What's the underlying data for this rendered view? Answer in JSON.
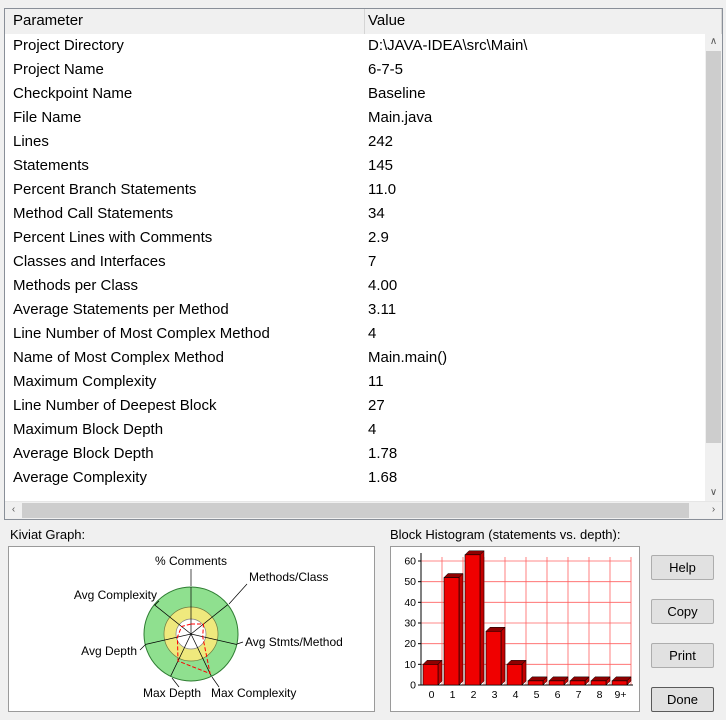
{
  "table": {
    "columns": [
      "Parameter",
      "Value"
    ],
    "rows": [
      [
        "Project Directory",
        "D:\\JAVA-IDEA\\src\\Main\\"
      ],
      [
        "Project Name",
        "6-7-5"
      ],
      [
        "Checkpoint Name",
        "Baseline"
      ],
      [
        "File Name",
        "Main.java"
      ],
      [
        "Lines",
        "242"
      ],
      [
        "Statements",
        "145"
      ],
      [
        "Percent Branch Statements",
        "11.0"
      ],
      [
        "Method Call Statements",
        "34"
      ],
      [
        "Percent Lines with Comments",
        "2.9"
      ],
      [
        "Classes and Interfaces",
        "7"
      ],
      [
        "Methods per Class",
        "4.00"
      ],
      [
        "Average Statements per Method",
        "3.11"
      ],
      [
        "Line Number of Most Complex Method",
        "4"
      ],
      [
        "Name of Most Complex Method",
        "Main.main()"
      ],
      [
        "Maximum Complexity",
        "11"
      ],
      [
        "Line Number of Deepest Block",
        "27"
      ],
      [
        "Maximum Block Depth",
        "4"
      ],
      [
        "Average Block Depth",
        "1.78"
      ],
      [
        "Average Complexity",
        "1.68"
      ]
    ]
  },
  "sections": {
    "kiviat_label": "Kiviat Graph:",
    "histogram_label": "Block Histogram (statements vs. depth):"
  },
  "buttons": {
    "help": "Help",
    "copy": "Copy",
    "print": "Print",
    "done": "Done"
  },
  "icons": {
    "scroll_up": "∧",
    "scroll_down": "∨",
    "scroll_left": "‹",
    "scroll_right": "›"
  },
  "colors": {
    "bar_red": "#f00000",
    "bar_top_red": "#8f0000",
    "bar_side_red": "#c40000",
    "grid_red": "#ff6060",
    "kiviat_green": "#8fe08f",
    "kiviat_yellow": "#efe97d",
    "polygon_red": "#ff0000"
  },
  "chart_data": [
    {
      "type": "bar",
      "title": "Block Histogram (statements vs. depth)",
      "categories": [
        "0",
        "1",
        "2",
        "3",
        "4",
        "5",
        "6",
        "7",
        "8",
        "9+"
      ],
      "values": [
        10,
        52,
        63,
        26,
        10,
        2,
        2,
        2,
        2,
        2
      ],
      "xlabel": "",
      "ylabel": "",
      "ylim": [
        0,
        65
      ],
      "yticks": [
        0,
        10,
        20,
        30,
        40,
        50,
        60
      ],
      "grid": true,
      "legend": "none"
    },
    {
      "type": "radar",
      "title": "Kiviat Graph",
      "axes": [
        "% Comments",
        "Methods/Class",
        "Avg Stmts/Method",
        "Max Complexity",
        "Max Depth",
        "Avg Depth",
        "Avg Complexity"
      ],
      "values": [
        2.9,
        4.0,
        3.11,
        11,
        4,
        1.78,
        1.68
      ]
    }
  ]
}
